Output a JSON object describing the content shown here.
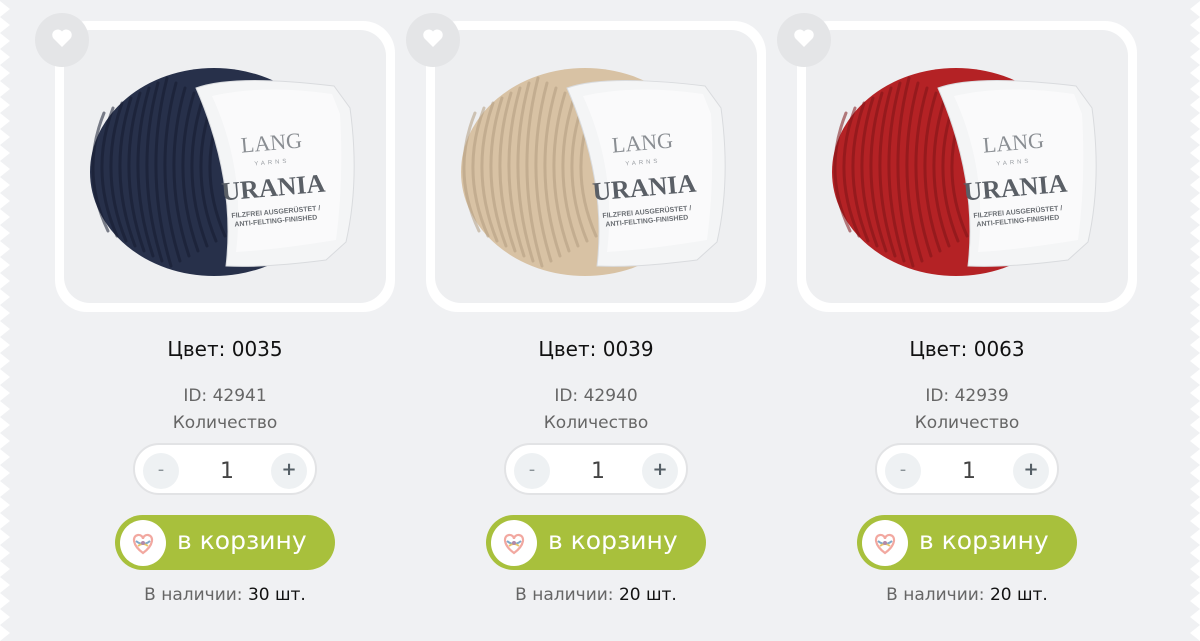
{
  "products": [
    {
      "color_label": "Цвет: 0035",
      "id_prefix": "ID:",
      "id_value": "42941",
      "qty_label": "Количество",
      "qty_value": "1",
      "minus": "-",
      "plus": "+",
      "cart_label": "в корзину",
      "stock_prefix": "В наличии:",
      "stock_value": "30 шт.",
      "yarn_color": "#27304a",
      "yarn_dark": "#161c30",
      "label_brand": "LANG",
      "label_sub": "YARNS",
      "label_name": "URANIA",
      "label_tag1": "FILZFREI AUSGERÜSTET /",
      "label_tag2": "ANTI-FELTING-FINISHED"
    },
    {
      "color_label": "Цвет: 0039",
      "id_prefix": "ID:",
      "id_value": "42940",
      "qty_label": "Количество",
      "qty_value": "1",
      "minus": "-",
      "plus": "+",
      "cart_label": "в корзину",
      "stock_prefix": "В наличии:",
      "stock_value": "20 шт.",
      "yarn_color": "#d8c2a4",
      "yarn_dark": "#b39d80",
      "label_brand": "LANG",
      "label_sub": "YARNS",
      "label_name": "URANIA",
      "label_tag1": "FILZFREI AUSGERÜSTET /",
      "label_tag2": "ANTI-FELTING-FINISHED"
    },
    {
      "color_label": "Цвет: 0063",
      "id_prefix": "ID:",
      "id_value": "42939",
      "qty_label": "Количество",
      "qty_value": "1",
      "minus": "-",
      "plus": "+",
      "cart_label": "в корзину",
      "stock_prefix": "В наличии:",
      "stock_value": "20 шт.",
      "yarn_color": "#b42225",
      "yarn_dark": "#7d1418",
      "label_brand": "LANG",
      "label_sub": "YARNS",
      "label_name": "URANIA",
      "label_tag1": "FILZFREI AUSGERÜSTET /",
      "label_tag2": "ANTI-FELTING-FINISHED"
    }
  ],
  "colors": {
    "background": "#f0f1f3",
    "cart_button": "#a8c03c",
    "favorite_circle": "#e4e5e7",
    "heart": "#ffffff"
  },
  "icons": {
    "favorite": "heart-icon",
    "cart": "yarn-heart-logo-icon"
  }
}
